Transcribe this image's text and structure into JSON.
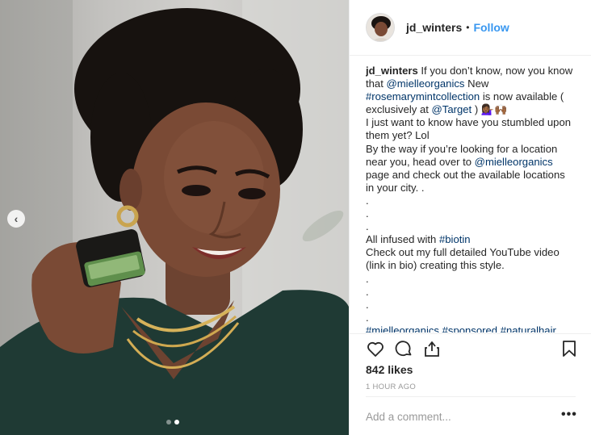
{
  "post": {
    "photo": {
      "description_icon": "portrait-photo"
    },
    "carousel": {
      "prev_icon": "chevron-left-icon",
      "prev_glyph": "‹",
      "slide_count": 2,
      "active_slide": 2
    }
  },
  "header": {
    "username": "jd_winters",
    "separator": "•",
    "follow_label": "Follow",
    "follow_color": "#3897f0"
  },
  "caption": {
    "username": "jd_winters",
    "lines": [
      {
        "parts": [
          {
            "t": " If you don’t know, now you know"
          }
        ]
      },
      {
        "parts": [
          {
            "t": "that "
          },
          {
            "t": "@mielleorganics",
            "link": true
          },
          {
            "t": " New"
          }
        ]
      },
      {
        "parts": [
          {
            "t": "#rosemarymintcollection",
            "link": true
          },
          {
            "t": " is now available ("
          }
        ]
      },
      {
        "parts": [
          {
            "t": "exclusively at "
          },
          {
            "t": "@Target",
            "link": true
          },
          {
            "t": " ) 💁🏾‍♀️🙌🏾"
          }
        ]
      },
      {
        "parts": [
          {
            "t": "I just want to know have you stumbled upon"
          }
        ]
      },
      {
        "parts": [
          {
            "t": "them yet? Lol"
          }
        ]
      },
      {
        "parts": [
          {
            "t": "By the way if you’re looking for a location"
          }
        ]
      },
      {
        "parts": [
          {
            "t": "near you, head over to "
          },
          {
            "t": "@mielleorganics",
            "link": true
          }
        ]
      },
      {
        "parts": [
          {
            "t": "page and check out the available locations"
          }
        ]
      },
      {
        "parts": [
          {
            "t": "in your city. ."
          }
        ]
      },
      {
        "parts": [
          {
            "t": "."
          }
        ]
      },
      {
        "parts": [
          {
            "t": "."
          }
        ]
      },
      {
        "parts": [
          {
            "t": "."
          }
        ]
      },
      {
        "parts": [
          {
            "t": "All infused with "
          },
          {
            "t": "#biotin",
            "link": true
          }
        ]
      },
      {
        "parts": [
          {
            "t": "Check out my full detailed YouTube video"
          }
        ]
      },
      {
        "parts": [
          {
            "t": "(link in bio) creating this style."
          }
        ]
      },
      {
        "parts": [
          {
            "t": "."
          }
        ]
      },
      {
        "parts": [
          {
            "t": "."
          }
        ]
      },
      {
        "parts": [
          {
            "t": "."
          }
        ]
      },
      {
        "parts": [
          {
            "t": "."
          }
        ]
      },
      {
        "parts": [
          {
            "t": "#mielleorganics",
            "link": true
          },
          {
            "t": " "
          },
          {
            "t": "#sponsored",
            "link": true
          },
          {
            "t": " "
          },
          {
            "t": "#naturalhair",
            "link": true
          }
        ]
      }
    ]
  },
  "actions": {
    "like_icon": "heart-icon",
    "comment_icon": "comment-icon",
    "share_icon": "share-icon",
    "save_icon": "bookmark-icon"
  },
  "likes": "842 likes",
  "timestamp": "1 HOUR AGO",
  "comment": {
    "placeholder": "Add a comment...",
    "value": "",
    "more_label": "•••"
  },
  "colors": {
    "link": "#003569",
    "follow": "#3897f0",
    "muted": "#999999",
    "text": "#262626"
  }
}
